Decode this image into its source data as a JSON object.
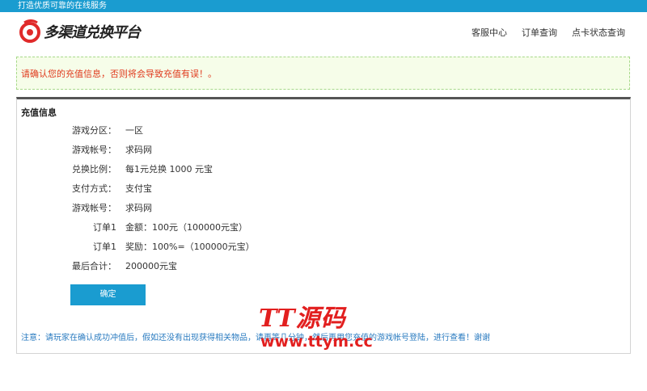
{
  "topbar": {
    "slogan": "打造优质可靠的在线服务"
  },
  "header": {
    "logo_text": "多渠道兑换平台",
    "nav": [
      "客服中心",
      "订单查询",
      "点卡状态查询"
    ]
  },
  "alert": {
    "text": "请确认您的充值信息，否则将会导致充值有误！。"
  },
  "panel": {
    "title": "充值信息",
    "rows": [
      {
        "label": "游戏分区：",
        "value": "一区"
      },
      {
        "label": "游戏帐号：",
        "value": "求码网"
      },
      {
        "label": "兑换比例：",
        "value": "每1元兑换 1000 元宝"
      },
      {
        "label": "支付方式：",
        "value": "支付宝"
      },
      {
        "label": "游戏帐号：",
        "value": "求码网"
      },
      {
        "label": "订单1",
        "value": "金额：100元（100000元宝）"
      },
      {
        "label": "订单1",
        "value": "奖励：100%=（100000元宝）"
      },
      {
        "label": "最后合计：",
        "value": "200000元宝"
      }
    ],
    "confirm_label": "确定",
    "notice": "注意：请玩家在确认成功冲值后，假如还没有出现获得相关物品，请再等几分钟，然后再用您充值的游戏帐号登陆，进行查看！谢谢"
  },
  "watermark": {
    "title": "TT源码",
    "url": "www.ttym.cc"
  },
  "colors": {
    "brand_blue": "#1a9cd0",
    "alert_red": "#e03a1e",
    "alert_bg": "#f6fde9",
    "logo_red": "#e02a2a"
  }
}
